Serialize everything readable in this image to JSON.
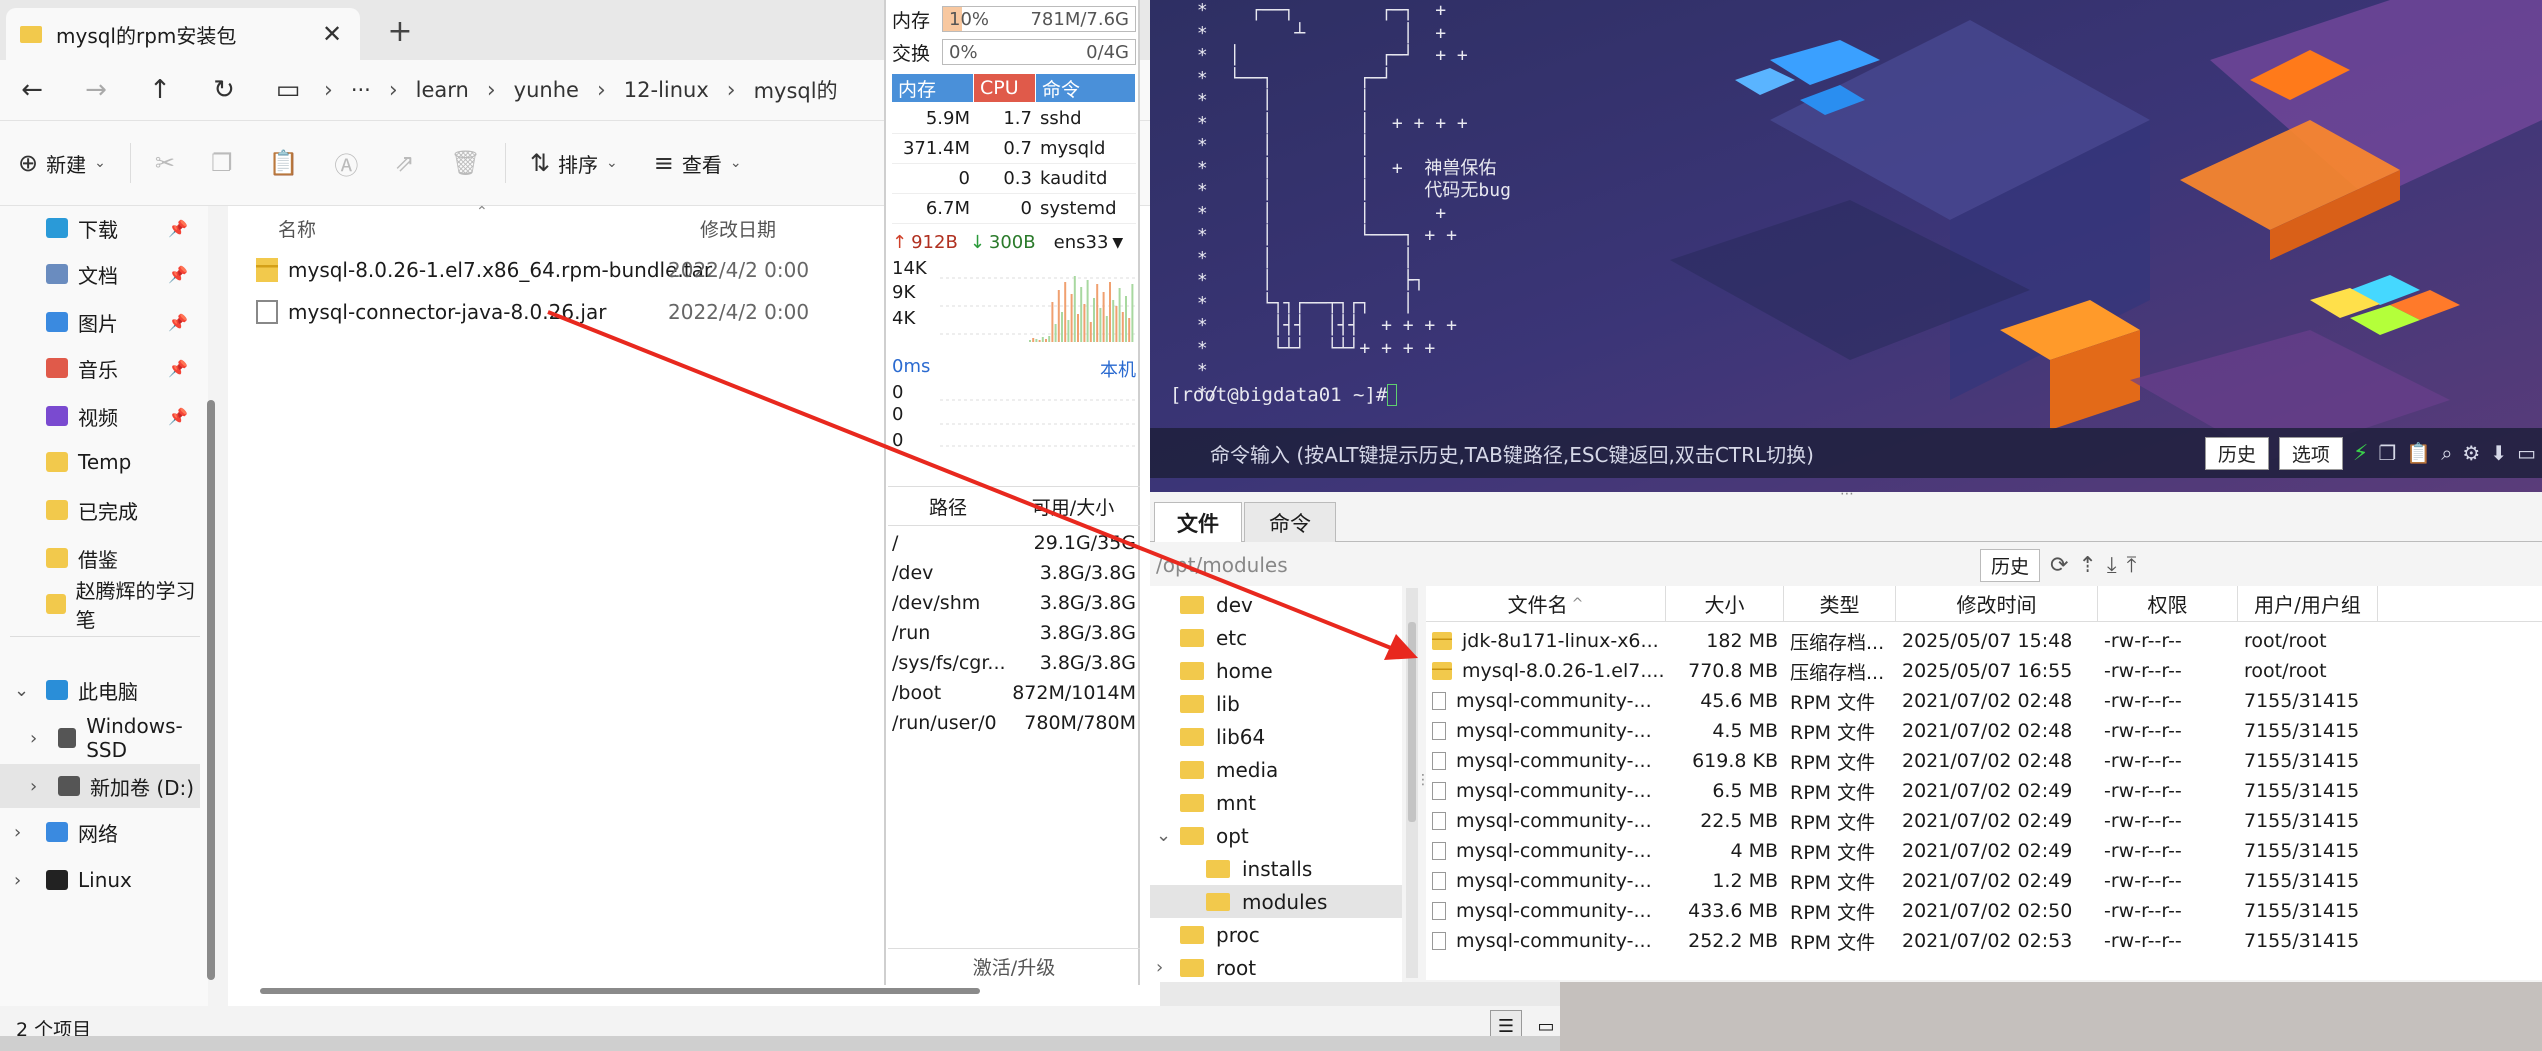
{
  "explorer": {
    "tab_title": "mysql的rpm安装包",
    "breadcrumb": [
      "learn",
      "yunhe",
      "12-linux",
      "mysql的"
    ],
    "toolbar": {
      "new_label": "新建",
      "sort_label": "排序",
      "view_label": "查看"
    },
    "nav": [
      {
        "label": "下载",
        "pinned": true,
        "icon": "download-icon"
      },
      {
        "label": "文档",
        "pinned": true,
        "icon": "document-icon"
      },
      {
        "label": "图片",
        "pinned": true,
        "icon": "image-icon"
      },
      {
        "label": "音乐",
        "pinned": true,
        "icon": "music-icon"
      },
      {
        "label": "视频",
        "pinned": true,
        "icon": "video-icon"
      },
      {
        "label": "Temp",
        "pinned": false,
        "icon": "folder-icon"
      },
      {
        "label": "已完成",
        "pinned": false,
        "icon": "folder-icon"
      },
      {
        "label": "借鉴",
        "pinned": false,
        "icon": "folder-icon"
      },
      {
        "label": "赵腾辉的学习笔",
        "pinned": false,
        "icon": "folder-icon"
      },
      {
        "label": "此电脑",
        "pinned": false,
        "icon": "pc-icon"
      },
      {
        "label": "Windows-SSD",
        "pinned": false,
        "icon": "drive-icon"
      },
      {
        "label": "新加卷 (D:)",
        "pinned": false,
        "icon": "drive-icon"
      },
      {
        "label": "网络",
        "pinned": false,
        "icon": "network-icon"
      },
      {
        "label": "Linux",
        "pinned": false,
        "icon": "linux-icon"
      }
    ],
    "columns": {
      "name": "名称",
      "modified": "修改日期"
    },
    "files": [
      {
        "name": "mysql-8.0.26-1.el7.x86_64.rpm-bundle.tar",
        "modified": "2022/4/2 0:00"
      },
      {
        "name": "mysql-connector-java-8.0.26.jar",
        "modified": "2022/4/2 0:00"
      }
    ],
    "status": "2 个项目"
  },
  "monitor": {
    "mem": {
      "label": "内存",
      "percent": "10%",
      "used": "781M/7.6G",
      "fraction": 0.1
    },
    "swap": {
      "label": "交换",
      "percent": "0%",
      "used": "0/4G",
      "fraction": 0
    },
    "proc_headers": [
      "内存",
      "CPU",
      "命令"
    ],
    "procs": [
      {
        "mem": "5.9M",
        "cpu": "1.7",
        "cmd": "sshd"
      },
      {
        "mem": "371.4M",
        "cpu": "0.7",
        "cmd": "mysqld"
      },
      {
        "mem": "0",
        "cpu": "0.3",
        "cmd": "kauditd"
      },
      {
        "mem": "6.7M",
        "cpu": "0",
        "cmd": "systemd"
      }
    ],
    "net": {
      "up": "912B",
      "down": "300B",
      "iface": "ens33",
      "y_ticks": [
        "14K",
        "9K",
        "4K"
      ]
    },
    "ping": {
      "latency": "0ms",
      "target": "本机",
      "values": [
        "0",
        "0",
        "0"
      ]
    },
    "disk_headers": [
      "路径",
      "可用/大小"
    ],
    "disks": [
      {
        "path": "/",
        "size": "29.1G/35G"
      },
      {
        "path": "/dev",
        "size": "3.8G/3.8G"
      },
      {
        "path": "/dev/shm",
        "size": "3.8G/3.8G"
      },
      {
        "path": "/run",
        "size": "3.8G/3.8G"
      },
      {
        "path": "/sys/fs/cgr...",
        "size": "3.8G/3.8G"
      },
      {
        "path": "/boot",
        "size": "872M/1014M"
      },
      {
        "path": "/run/user/0",
        "size": "780M/780M"
      }
    ],
    "activate": "激活/升级"
  },
  "terminal": {
    "banner_lines": [
      " *    ┌──┐        ┌─┐  +",
      " *        ┴         │  +",
      " *  │             ┌─┘  + +",
      " *  └──┐        ┌─┘",
      " *     │        │",
      " *     │        │  + + + +",
      " *     │        │",
      " *     │        │  +  神兽保佑",
      " *     │        │     代码无bug",
      " *     │        │      +",
      " *     │        └───┐ + +",
      " *     │            │",
      " *     │            ├┐",
      " *     └┐┐┌──┬┐┌┐   │",
      " *      │┤┤  │┤┤  + + + +",
      " *      └┴┘  └┴┘+ + + +",
      " *",
      " */"
    ],
    "prompt": "[root@bigdata01 ~]# ",
    "cmd_hint": "命令输入 (按ALT键提示历史,TAB键路径,ESC键返回,双击CTRL切换)",
    "history_btn": "历史",
    "options_btn": "选项"
  },
  "sftp": {
    "tabs": [
      "文件",
      "命令"
    ],
    "path": "/opt/modules",
    "history_btn": "历史",
    "tree": [
      {
        "label": "dev",
        "level": 0
      },
      {
        "label": "etc",
        "level": 0
      },
      {
        "label": "home",
        "level": 0
      },
      {
        "label": "lib",
        "level": 0
      },
      {
        "label": "lib64",
        "level": 0
      },
      {
        "label": "media",
        "level": 0
      },
      {
        "label": "mnt",
        "level": 0
      },
      {
        "label": "opt",
        "level": 0
      },
      {
        "label": "installs",
        "level": 1
      },
      {
        "label": "modules",
        "level": 1
      },
      {
        "label": "proc",
        "level": 0
      },
      {
        "label": "root",
        "level": 0
      }
    ],
    "headers": [
      "文件名",
      "大小",
      "类型",
      "修改时间",
      "权限",
      "用户/用户组"
    ],
    "files": [
      {
        "name": "jdk-8u171-linux-x6...",
        "size": "182 MB",
        "type": "压缩存档...",
        "mtime": "2025/05/07 15:48",
        "perm": "-rw-r--r--",
        "owner": "root/root",
        "icon": "archive-icon"
      },
      {
        "name": "mysql-8.0.26-1.el7....",
        "size": "770.8 MB",
        "type": "压缩存档...",
        "mtime": "2025/05/07 16:55",
        "perm": "-rw-r--r--",
        "owner": "root/root",
        "icon": "archive-icon"
      },
      {
        "name": "mysql-community-...",
        "size": "45.6 MB",
        "type": "RPM 文件",
        "mtime": "2021/07/02 02:48",
        "perm": "-rw-r--r--",
        "owner": "7155/31415",
        "icon": "file-icon"
      },
      {
        "name": "mysql-community-...",
        "size": "4.5 MB",
        "type": "RPM 文件",
        "mtime": "2021/07/02 02:48",
        "perm": "-rw-r--r--",
        "owner": "7155/31415",
        "icon": "file-icon"
      },
      {
        "name": "mysql-community-...",
        "size": "619.8 KB",
        "type": "RPM 文件",
        "mtime": "2021/07/02 02:48",
        "perm": "-rw-r--r--",
        "owner": "7155/31415",
        "icon": "file-icon"
      },
      {
        "name": "mysql-community-...",
        "size": "6.5 MB",
        "type": "RPM 文件",
        "mtime": "2021/07/02 02:49",
        "perm": "-rw-r--r--",
        "owner": "7155/31415",
        "icon": "file-icon"
      },
      {
        "name": "mysql-community-...",
        "size": "22.5 MB",
        "type": "RPM 文件",
        "mtime": "2021/07/02 02:49",
        "perm": "-rw-r--r--",
        "owner": "7155/31415",
        "icon": "file-icon"
      },
      {
        "name": "mysql-community-...",
        "size": "4 MB",
        "type": "RPM 文件",
        "mtime": "2021/07/02 02:49",
        "perm": "-rw-r--r--",
        "owner": "7155/31415",
        "icon": "file-icon"
      },
      {
        "name": "mysql-community-...",
        "size": "1.2 MB",
        "type": "RPM 文件",
        "mtime": "2021/07/02 02:49",
        "perm": "-rw-r--r--",
        "owner": "7155/31415",
        "icon": "file-icon"
      },
      {
        "name": "mysql-community-...",
        "size": "433.6 MB",
        "type": "RPM 文件",
        "mtime": "2021/07/02 02:50",
        "perm": "-rw-r--r--",
        "owner": "7155/31415",
        "icon": "file-icon"
      },
      {
        "name": "mysql-community-...",
        "size": "252.2 MB",
        "type": "RPM 文件",
        "mtime": "2021/07/02 02:53",
        "perm": "-rw-r--r--",
        "owner": "7155/31415",
        "icon": "file-icon"
      }
    ]
  },
  "colors": {
    "arrow": "#e8281e",
    "accent": "#4a90d9",
    "folder": "#f2c94c",
    "terminal_bg": "#2a2d5a"
  }
}
